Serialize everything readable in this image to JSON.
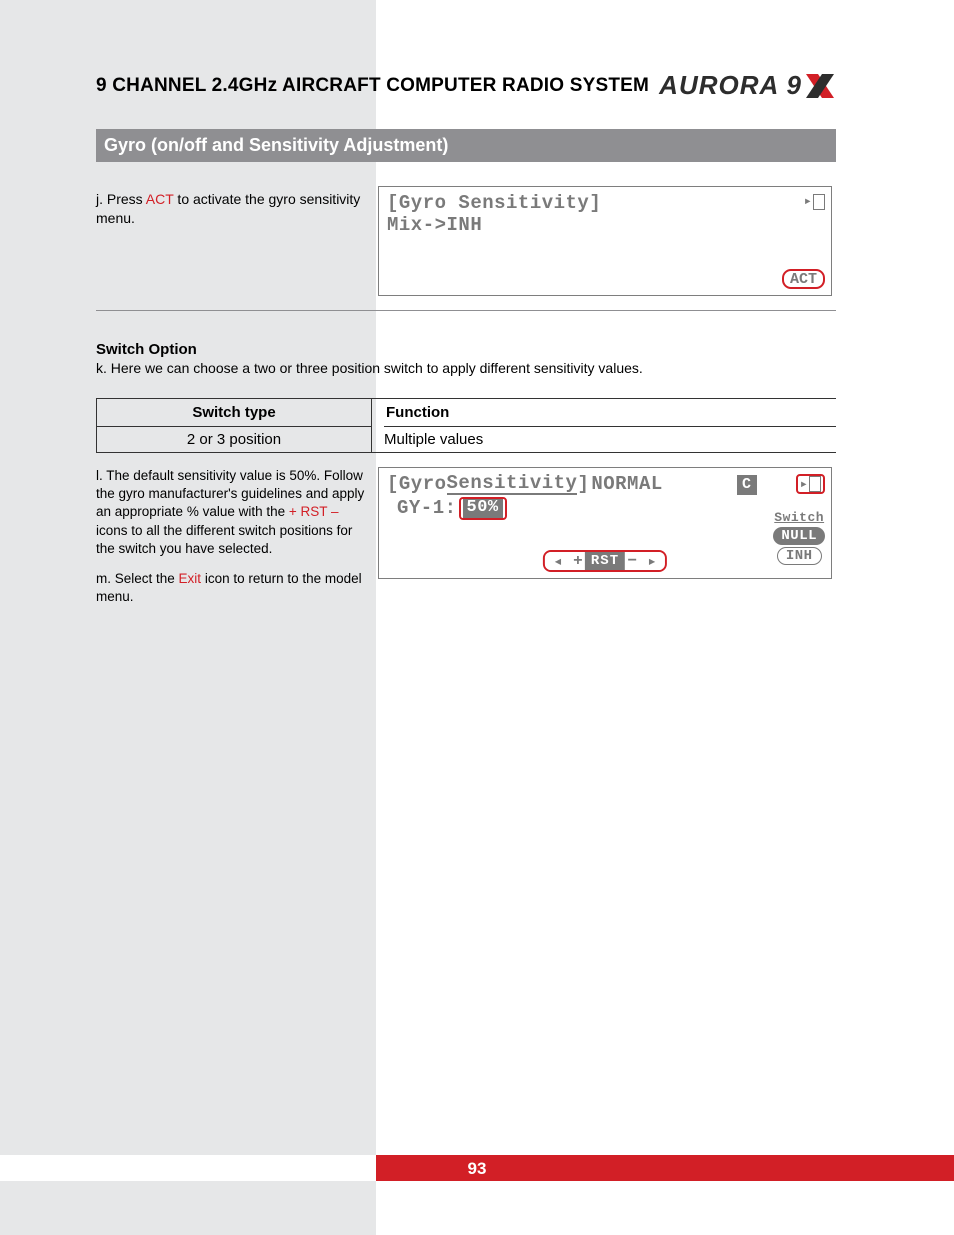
{
  "header": {
    "title": "9 CHANNEL 2.4GHz AIRCRAFT COMPUTER RADIO SYSTEM",
    "logo_text": "AURORA 9"
  },
  "section_bar": "Gyro (on/off and Sensitivity Adjustment)",
  "step_j": {
    "prefix": "j. Press ",
    "act": "ACT",
    "suffix": " to activate the gyro sensitivity menu."
  },
  "lcd1": {
    "line1": "[Gyro Sensitivity]",
    "line2": "Mix->INH",
    "act_label": "ACT"
  },
  "switch_option": {
    "heading": "Switch Option",
    "desc": "k. Here we can choose a two or three position switch to apply different sensitivity values.",
    "table": {
      "col1_head": "Switch type",
      "col2_head": "Function",
      "col1_val": "2 or 3 position",
      "col2_val": "Multiple values"
    }
  },
  "step_l": {
    "prefix": "l. The default sensitivity value is 50%. Follow the gyro manufacturer's guidelines and apply an appropriate % value with the ",
    "plus": "+",
    "rst": " RST ",
    "minus": "–",
    "suffix": " icons to all the different switch positions for the switch you have selected."
  },
  "step_m": {
    "prefix": "m. Select the ",
    "exit": "Exit",
    "suffix": " icon to return to the model menu."
  },
  "lcd2": {
    "title_open": "[Gyro ",
    "title_und": "Sensitivity",
    "title_close": "]",
    "mode": "NORMAL",
    "c_label": "C",
    "gy_label": "GY-1:",
    "gy_value": "50%",
    "switch_label": "Switch",
    "null_label": "NULL",
    "inh_label": "INH",
    "rst_label": "RST"
  },
  "page_number": "93"
}
